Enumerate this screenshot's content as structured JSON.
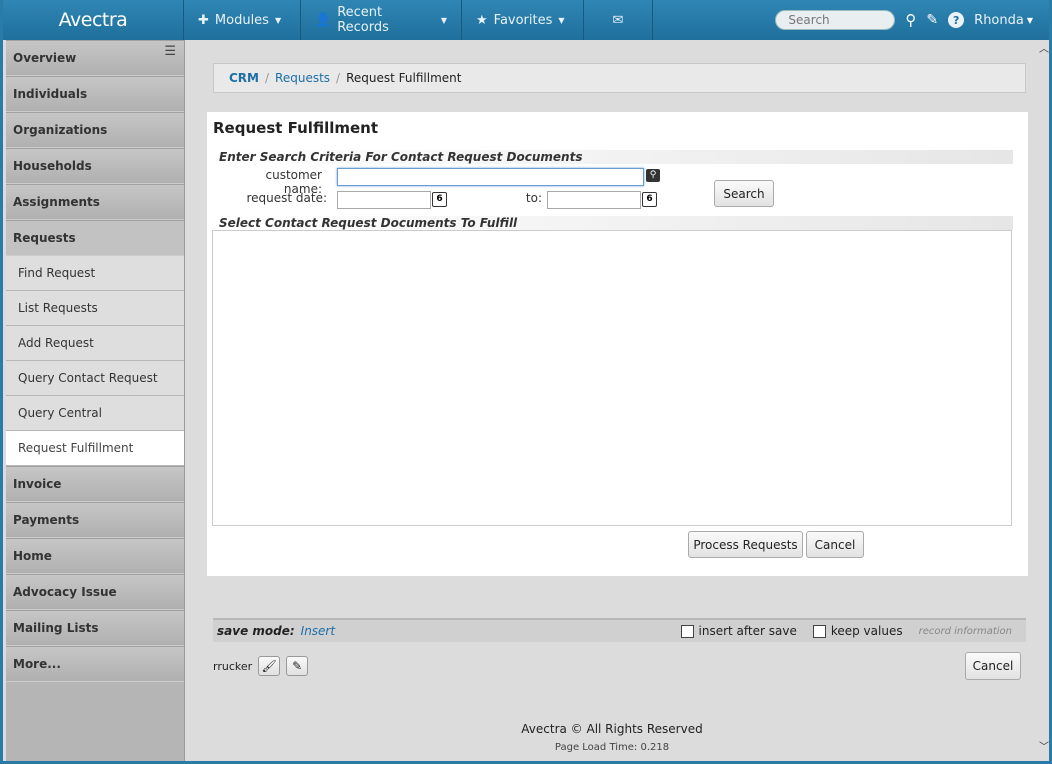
{
  "topnav": {
    "logo": "Avectra",
    "modules": "Modules",
    "recent": "Recent Records",
    "favorites": "Favorites",
    "search_placeholder": "Search",
    "user": "Rhonda"
  },
  "sidebar": {
    "items": [
      {
        "label": "Overview"
      },
      {
        "label": "Individuals"
      },
      {
        "label": "Organizations"
      },
      {
        "label": "Households"
      },
      {
        "label": "Assignments"
      },
      {
        "label": "Requests"
      }
    ],
    "sub_items": [
      {
        "label": "Find Request"
      },
      {
        "label": "List Requests"
      },
      {
        "label": "Add Request"
      },
      {
        "label": "Query Contact Request"
      },
      {
        "label": "Query Central"
      },
      {
        "label": "Request Fulfillment"
      }
    ],
    "items_after": [
      {
        "label": "Invoice"
      },
      {
        "label": "Payments"
      },
      {
        "label": "Home"
      },
      {
        "label": "Advocacy Issue"
      },
      {
        "label": "Mailing Lists"
      },
      {
        "label": "More..."
      }
    ]
  },
  "breadcrumb": {
    "root": "CRM",
    "parent": "Requests",
    "current": "Request Fulfillment"
  },
  "form": {
    "title": "Request Fulfillment",
    "criteria_heading": "Enter Search Criteria For Contact Request Documents",
    "customer_name_label": "customer name:",
    "customer_name_value": "",
    "request_date_label": "request date:",
    "request_date_value": "",
    "to_label": "to:",
    "to_value": "",
    "calendar_day": "6",
    "search_button": "Search",
    "results_heading": "Select Contact Request Documents To Fulfill",
    "process_button": "Process Requests",
    "cancel_button": "Cancel"
  },
  "savebar": {
    "mode_label": "save mode:",
    "mode_value": "Insert",
    "insert_after_save": "insert after save",
    "keep_values": "keep values",
    "record_information": "record information"
  },
  "bottom": {
    "username": "rrucker",
    "cancel_button": "Cancel",
    "copyright": "Avectra © All Rights Reserved",
    "load_time": "Page Load Time: 0.218"
  }
}
